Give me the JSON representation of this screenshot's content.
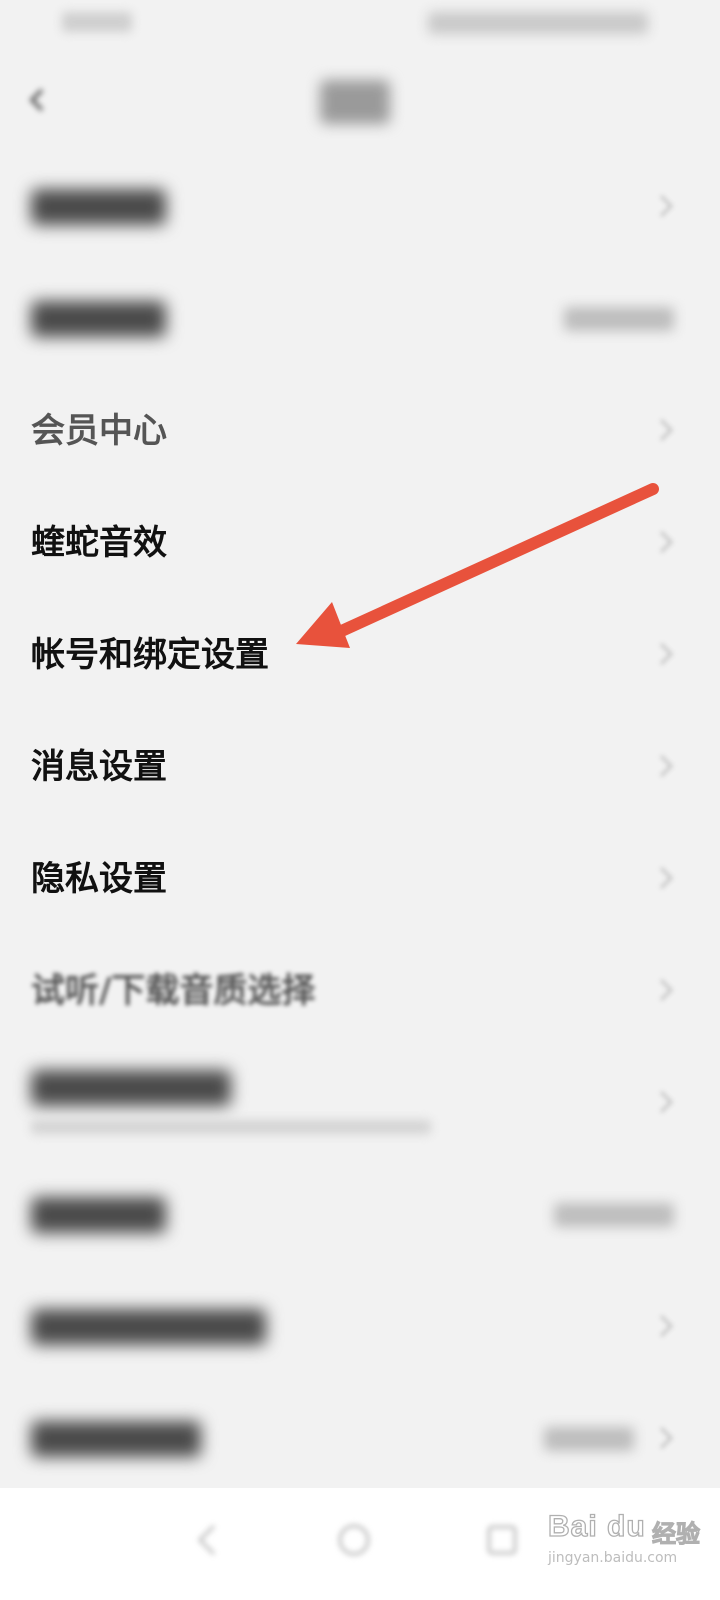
{
  "header": {
    "back_icon": "back-icon",
    "title_blurred": true
  },
  "settings": {
    "items": [
      {
        "label": "",
        "blurred": true,
        "chevron": true
      },
      {
        "label": "",
        "blurred": true,
        "right_value_blurred": true
      },
      {
        "label": "会员中心",
        "chevron": true
      },
      {
        "label": "蝰蛇音效",
        "chevron": true
      },
      {
        "label": "帐号和绑定设置",
        "chevron": true
      },
      {
        "label": "消息设置",
        "chevron": true
      },
      {
        "label": "隐私设置",
        "chevron": true
      },
      {
        "label": "试听/下载音质选择",
        "chevron": true
      },
      {
        "label": "",
        "blurred": true,
        "has_subtext": true,
        "chevron": true
      },
      {
        "label": "",
        "blurred": true,
        "right_value_blurred": true
      },
      {
        "label": "",
        "blurred": true,
        "chevron": true
      },
      {
        "label": "",
        "blurred": true,
        "right_value_blurred": true,
        "chevron": true
      }
    ]
  },
  "annotation": {
    "color": "#e8523c",
    "target": "帐号和绑定设置"
  },
  "watermark": {
    "logo": "Bai du",
    "cn": "经验",
    "url": "jingyan.baidu.com"
  },
  "colors": {
    "background": "#f2f2f2",
    "nav_background": "#ffffff",
    "text": "#111111"
  }
}
